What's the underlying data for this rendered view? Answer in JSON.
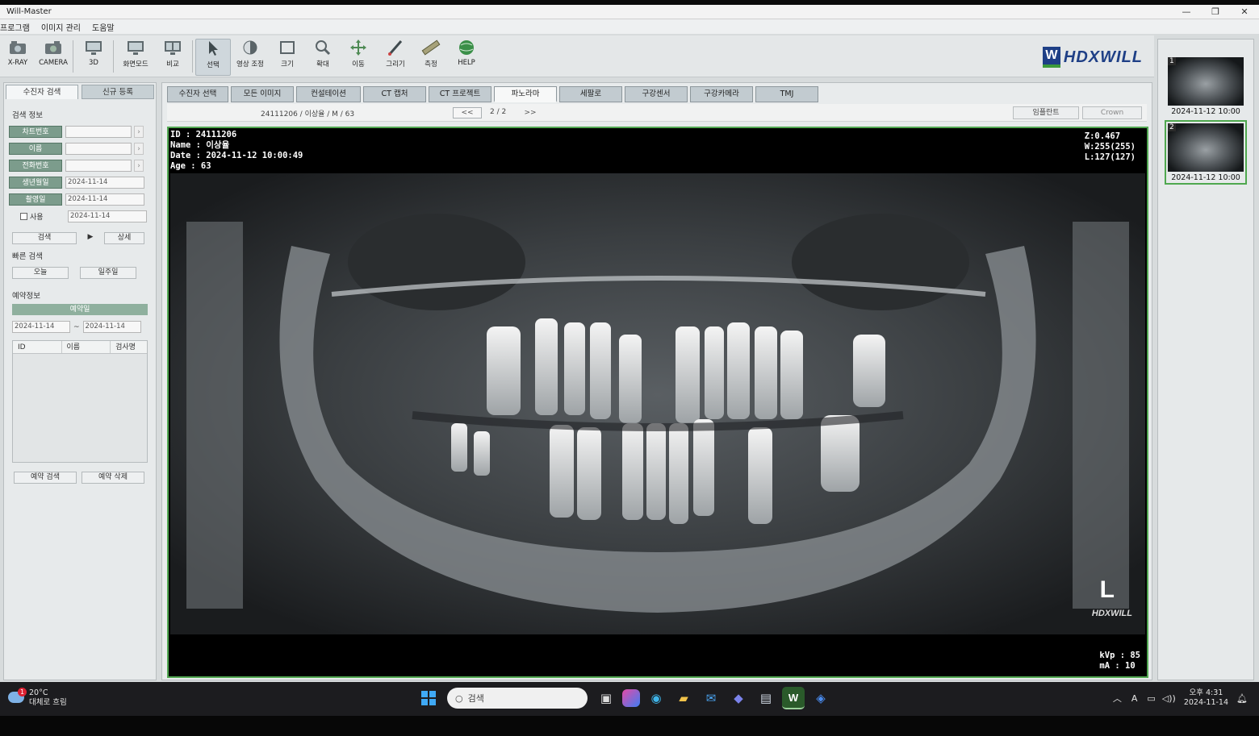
{
  "window": {
    "title": "Will-Master",
    "minimize": "—",
    "restore": "❐",
    "close": "✕"
  },
  "menu": [
    "프로그램",
    "이미지 관리",
    "도움말"
  ],
  "toolbar": {
    "xray": "X-RAY",
    "camera": "CAMERA",
    "threed": "3D",
    "screen_mode": "화면모드",
    "compare": "비교",
    "select": "선택",
    "image_adjust": "영상 조정",
    "zoom_in_out": "크기",
    "magnify": "확대",
    "move": "이동",
    "draw": "그리기",
    "measure": "측정",
    "help": "HELP",
    "logo_letter": "W",
    "logo_text": "HDXWILL"
  },
  "left": {
    "tab_search": "수진자 검색",
    "tab_new": "신규 등록",
    "search_info_title": "검색 정보",
    "chart_no_label": "차트번호",
    "name_label": "이름",
    "phone_label": "전화번호",
    "birth_label": "생년월일",
    "birth_value": "2024-11-14",
    "shot_date_label": "촬영일",
    "shot_date_value": "2024-11-14",
    "use_label": "사용",
    "use_value": "2024-11-14",
    "search_btn": "검색",
    "play_btn": "▶",
    "detail_btn": "상세",
    "quick_search_title": "빠른 검색",
    "today_btn": "오늘",
    "week_btn": "일주일",
    "reservation_title": "예약정보",
    "reservation_date_bar": "예약일",
    "res_from": "2024-11-14",
    "res_tilde": "~",
    "res_to": "2024-11-14",
    "col_id": "ID",
    "col_name": "이름",
    "col_exam": "검사명",
    "res_search_btn": "예약 검색",
    "res_delete_btn": "예약 삭제"
  },
  "main": {
    "tabs": [
      "수진자 선택",
      "모든 이미지",
      "컨설테이션",
      "CT 캡처",
      "CT 프로젝트",
      "파노라마",
      "세팔로",
      "구강센서",
      "구강카메라",
      "TMJ"
    ],
    "active_tab": "파노라마",
    "patient_info": "24111206 / 이상율 / M / 63",
    "prev_btn": "<<",
    "pager": "2 / 2",
    "next_btn": ">>",
    "implant_btn": "임플란트",
    "crown_btn": "Crown"
  },
  "overlay": {
    "id_line": "ID : 24111206",
    "name_line": "Name : 이상율",
    "date_line": "Date : 2024-11-12 10:00:49",
    "age_line": "Age : 63",
    "zoom_line": "Z:0.467",
    "window_line": "W:255(255)",
    "level_line": "L:127(127)",
    "side_marker": "L",
    "watermark": "HDXWILL",
    "kvp_line": "kVp : 85",
    "ma_line": "mA : 10"
  },
  "thumbnails": [
    {
      "num": "1",
      "date": "2024-11-12 10:00",
      "selected": false
    },
    {
      "num": "2",
      "date": "2024-11-12 10:00",
      "selected": true
    }
  ],
  "taskbar": {
    "weather_temp": "20°C",
    "weather_desc": "대체로 흐림",
    "weather_badge": "1",
    "search_placeholder": "검색",
    "tray_a": "A",
    "time": "오후 4:31",
    "date": "2024-11-14"
  },
  "colors": {
    "accent_green": "#52a852",
    "label_green": "#7c9c8c",
    "logo_blue": "#1e3f86"
  }
}
